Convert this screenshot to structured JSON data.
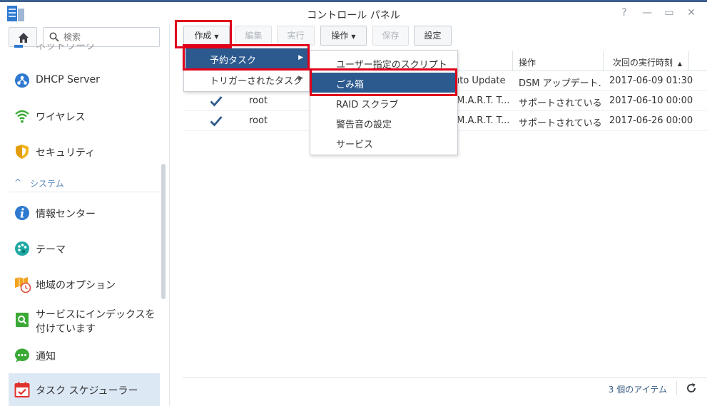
{
  "window": {
    "title": "コントロール パネル",
    "controls": [
      "?",
      "—",
      "▭",
      "✕"
    ]
  },
  "sidebar": {
    "search_placeholder": "検索",
    "cut_item": "ネットワーク",
    "items": [
      {
        "label": "DHCP Server",
        "icon": "dhcp-server-icon"
      },
      {
        "label": "ワイヤレス",
        "icon": "wifi-icon"
      },
      {
        "label": "セキュリティ",
        "icon": "shield-icon"
      },
      {
        "label": "情報センター",
        "icon": "info-icon"
      },
      {
        "label": "テーマ",
        "icon": "palette-icon"
      },
      {
        "label": "地域のオプション",
        "icon": "regional-clock-icon"
      },
      {
        "label": "サービスにインデックスを付けています",
        "icon": "indexing-search-icon"
      },
      {
        "label": "通知",
        "icon": "chat-bubble-icon"
      },
      {
        "label": "タスク スケジューラー",
        "icon": "calendar-check-icon"
      }
    ],
    "section": {
      "label": "システム",
      "chevron": "^"
    }
  },
  "toolbar": {
    "create": "作成",
    "edit": "編集",
    "run": "実行",
    "action": "操作",
    "save": "保存",
    "settings": "設定"
  },
  "grid": {
    "headers": {
      "action": "操作",
      "next_run": "次回の実行時刻",
      "sort_arrow": "▲"
    },
    "rows": [
      {
        "checked": false,
        "owner": "",
        "task": "uto Update",
        "action": "DSM アップデート...",
        "next_run": "2017-06-09 01:30"
      },
      {
        "checked": true,
        "owner": "root",
        "task": ".M.A.R.T. T...",
        "action": "サポートされている...",
        "next_run": "2017-06-10 00:00"
      },
      {
        "checked": true,
        "owner": "root",
        "task": ".M.A.R.T. T...",
        "action": "サポートされている...",
        "next_run": "2017-06-26 00:00"
      }
    ],
    "footer_count": "3 個のアイテム"
  },
  "menu_create": {
    "items": [
      {
        "label": "予約タスク",
        "highlighted": true
      },
      {
        "label": "トリガーされたタスク",
        "highlighted": false
      }
    ]
  },
  "menu_scheduled": {
    "items": [
      {
        "label": "ユーザー指定のスクリプト",
        "highlighted": false
      },
      {
        "label": "ごみ箱",
        "highlighted": true
      },
      {
        "label": "RAID スクラブ",
        "highlighted": false
      },
      {
        "label": "警告音の設定",
        "highlighted": false
      },
      {
        "label": "サービス",
        "highlighted": false
      }
    ]
  },
  "colors": {
    "accent": "#2c5a8e",
    "annotation_red": "#e0001a",
    "sidebar_active": "#dde8f5"
  }
}
